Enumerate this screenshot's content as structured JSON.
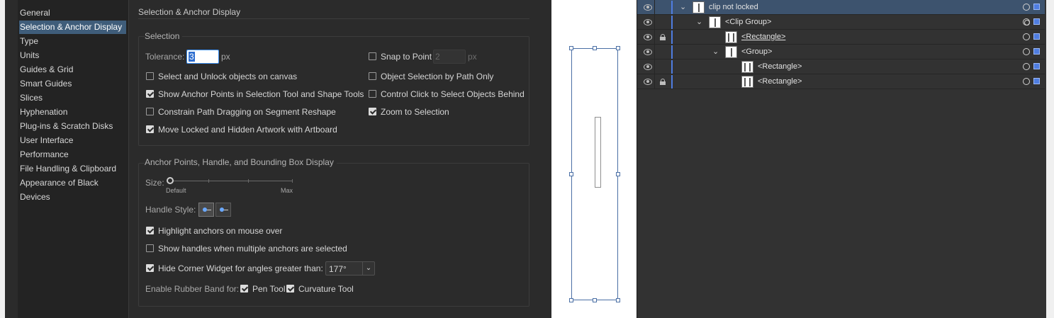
{
  "categories": [
    {
      "label": "General",
      "selected": false
    },
    {
      "label": "Selection & Anchor Display",
      "selected": true
    },
    {
      "label": "Type",
      "selected": false
    },
    {
      "label": "Units",
      "selected": false
    },
    {
      "label": "Guides & Grid",
      "selected": false
    },
    {
      "label": "Smart Guides",
      "selected": false
    },
    {
      "label": "Slices",
      "selected": false
    },
    {
      "label": "Hyphenation",
      "selected": false
    },
    {
      "label": "Plug-ins & Scratch Disks",
      "selected": false
    },
    {
      "label": "User Interface",
      "selected": false
    },
    {
      "label": "Performance",
      "selected": false
    },
    {
      "label": "File Handling & Clipboard",
      "selected": false
    },
    {
      "label": "Appearance of Black",
      "selected": false
    },
    {
      "label": "Devices",
      "selected": false
    }
  ],
  "pane": {
    "title": "Selection & Anchor Display"
  },
  "selection": {
    "title": "Selection",
    "tolerance_label": "Tolerance:",
    "tolerance_value": "3",
    "tolerance_unit": "px",
    "snap_label": "Snap to Point",
    "snap_value": "2",
    "snap_unit": "px",
    "options": {
      "select_unlock": {
        "label": "Select and Unlock objects on canvas",
        "checked": false
      },
      "object_by_path": {
        "label": "Object Selection by Path Only",
        "checked": false
      },
      "show_anchor_points": {
        "label": "Show Anchor Points in Selection Tool and Shape Tools",
        "checked": true
      },
      "control_click": {
        "label": "Control Click to Select Objects Behind",
        "checked": false
      },
      "constrain_path": {
        "label": "Constrain Path Dragging on Segment Reshape",
        "checked": false
      },
      "zoom_to_selection": {
        "label": "Zoom to Selection",
        "checked": true
      },
      "move_locked": {
        "label": "Move Locked and Hidden Artwork with Artboard",
        "checked": true
      }
    }
  },
  "anchor": {
    "title": "Anchor Points, Handle, and Bounding Box Display",
    "size_label": "Size:",
    "size_min_label": "Default",
    "size_max_label": "Max",
    "size_value": 0,
    "handle_style_label": "Handle Style:",
    "highlight": {
      "label": "Highlight anchors on mouse over",
      "checked": true
    },
    "show_handles": {
      "label": "Show handles when multiple anchors are selected",
      "checked": false
    },
    "hide_corner": {
      "label": "Hide Corner Widget for angles greater than:",
      "checked": true
    },
    "corner_angle": "177°",
    "rubber_band_label": "Enable Rubber Band for:",
    "pen_tool": {
      "label": "Pen Tool",
      "checked": true
    },
    "curvature_tool": {
      "label": "Curvature Tool",
      "checked": true
    }
  },
  "layers": [
    {
      "name": "clip not locked",
      "locked": false,
      "expanded": true,
      "underline": false,
      "target": "single"
    },
    {
      "name": "<Clip Group>",
      "locked": false,
      "expanded": true,
      "underline": false,
      "target": "double"
    },
    {
      "name": "<Rectangle>",
      "locked": true,
      "expanded": false,
      "underline": true,
      "target": "single"
    },
    {
      "name": "<Group>",
      "locked": false,
      "expanded": true,
      "underline": false,
      "target": "single"
    },
    {
      "name": "<Rectangle>",
      "locked": false,
      "expanded": false,
      "underline": false,
      "target": "single"
    },
    {
      "name": "<Rectangle>",
      "locked": true,
      "expanded": false,
      "underline": false,
      "target": "single"
    }
  ],
  "colors": {
    "layer_color": "#4f7de0",
    "selected_category": "#3f5d7a",
    "top_row": "#3d536e"
  }
}
